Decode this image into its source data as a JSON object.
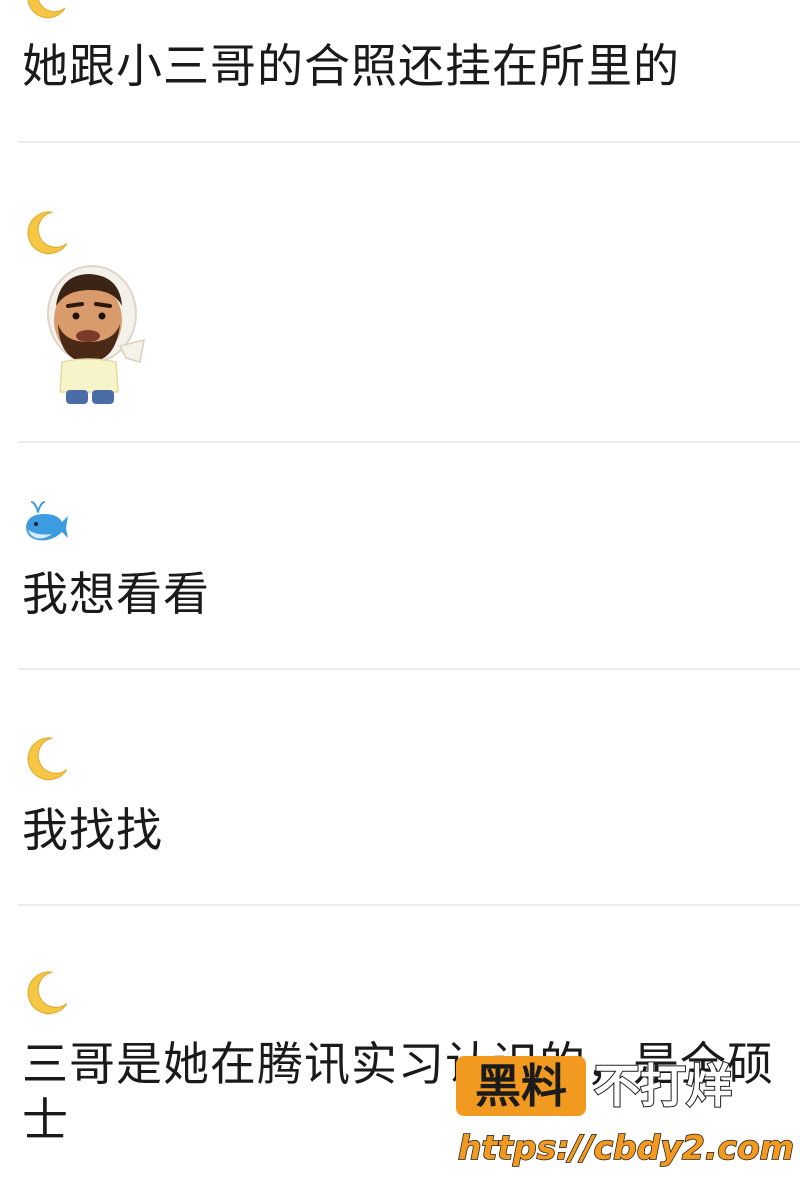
{
  "messages": [
    {
      "avatar": "crescent-moon-icon",
      "text": "她跟小三哥的合照还挂在所里的"
    },
    {
      "avatar": "crescent-moon-icon",
      "sticker": "bearded-man-sticker"
    },
    {
      "avatar": "whale-icon",
      "text": "我想看看"
    },
    {
      "avatar": "crescent-moon-icon",
      "text": "我找找"
    },
    {
      "avatar": "crescent-moon-icon",
      "text": "三哥是她在腾讯实习认识的，是全硕士"
    }
  ],
  "watermark": {
    "badge": "黑料",
    "title": "不打烊",
    "url": "https://cbdy2.com"
  },
  "colors": {
    "separator": "#ececec",
    "moon": "#f6c744",
    "whale": "#3d9be0",
    "watermark_orange": "#f29a1f"
  }
}
